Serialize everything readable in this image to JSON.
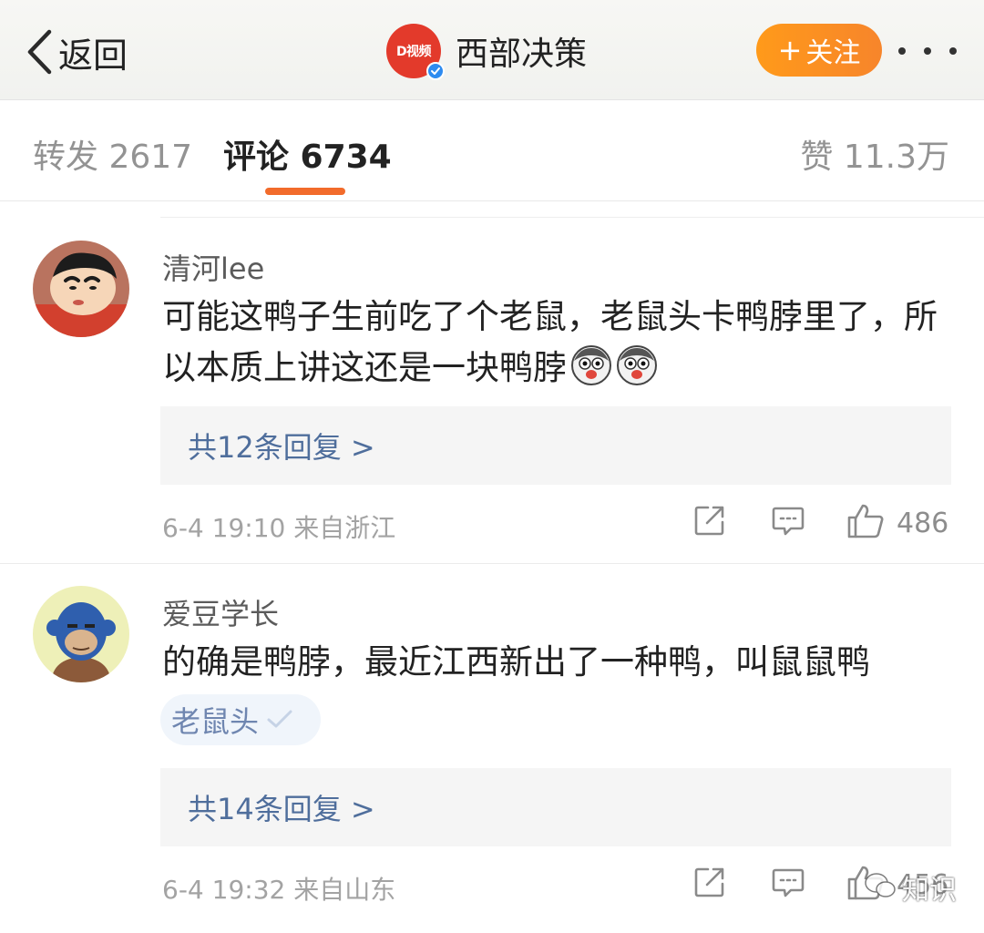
{
  "header": {
    "back_label": "返回",
    "account_name": "西部决策",
    "account_logo_text": "D视频",
    "follow_label": "关注",
    "icons": {
      "back": "chevron-left-icon",
      "more": "more-dots-icon",
      "verified": "verified-badge-icon"
    }
  },
  "tabs": {
    "repost": "转发 2617",
    "comments": "评论 6734",
    "likes": "赞 11.3万"
  },
  "comments": [
    {
      "username": "清河lee",
      "text": "可能这鸭子生前吃了个老鼠，老鼠头卡鸭脖里了，所以本质上讲这还是一块鸭脖",
      "emojis": [
        "husky-emoji",
        "husky-emoji"
      ],
      "replies_label": "共12条回复 >",
      "time": "6-4 19:10",
      "location": "来自浙江",
      "likes": "486"
    },
    {
      "username": "爱豆学长",
      "text": "的确是鸭脖，最近江西新出了一种鸭，叫鼠鼠鸭",
      "tag": "老鼠头",
      "replies_label": "共14条回复 >",
      "time": "6-4 19:32",
      "location": "来自山东",
      "likes": "456"
    }
  ],
  "watermark": "知识",
  "colors": {
    "follow_orange": "#f7852b",
    "tab_underline": "#f26b2b",
    "link_blue": "#4f6e9c",
    "verified_blue": "#2d8bf0",
    "logo_red": "#e33a2b"
  }
}
